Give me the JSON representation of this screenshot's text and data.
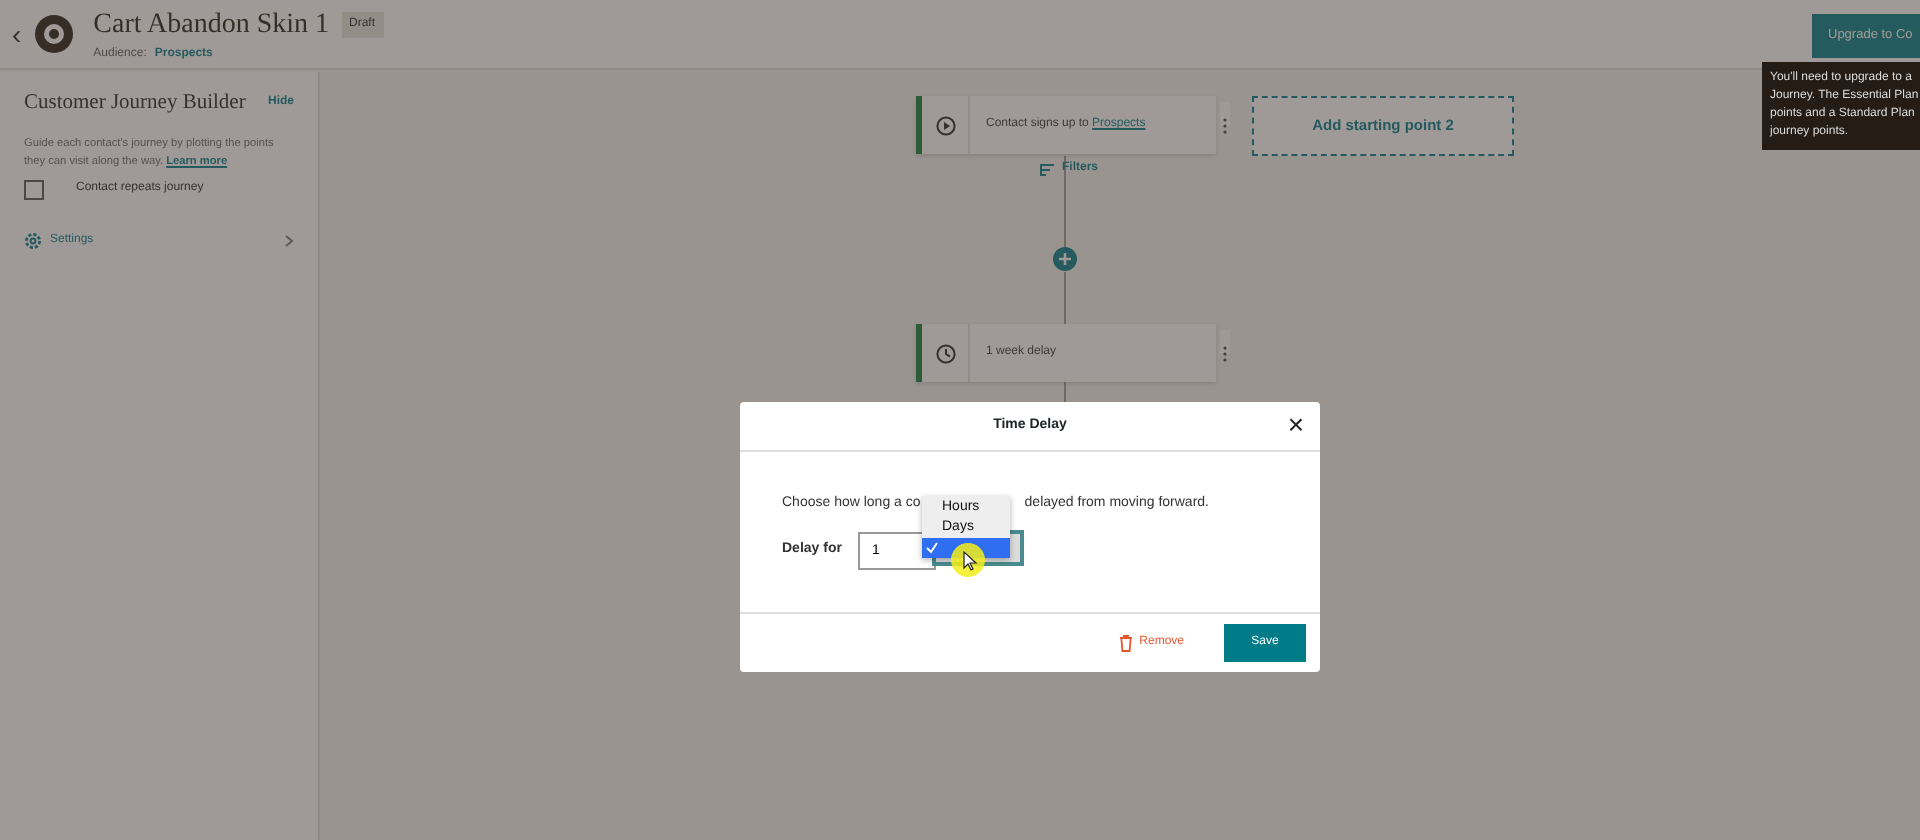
{
  "header": {
    "back": "‹",
    "title": "Cart Abandon Skin 1",
    "status": "Draft",
    "audience_label": "Audience:",
    "audience": "Prospects",
    "upgrade_button": "Upgrade to Co"
  },
  "tooltip": {
    "lines": [
      "You'll need to upgrade to a",
      "Journey. The Essential Plan",
      "points and a Standard Plan",
      "journey points."
    ]
  },
  "sidebar": {
    "title": "Customer Journey Builder",
    "hide": "Hide",
    "description": "Guide each contact's journey by plotting the points they can visit along the way.",
    "learn_more": "Learn more",
    "repeat": {
      "label": "Contact repeats journey",
      "checked": false
    },
    "settings": "Settings"
  },
  "canvas": {
    "nodes": [
      {
        "kind": "trigger",
        "text": "Contact signs up to",
        "link": "Prospects"
      },
      {
        "kind": "delay",
        "text": "1 week delay"
      }
    ],
    "add_start": "Add starting point 2",
    "filters": "Filters"
  },
  "dialog": {
    "title": "Time Delay",
    "close": "×",
    "text_before": "Choose how long a co",
    "text_after": "delayed from moving forward.",
    "delay_label": "Delay for",
    "delay_value": "1",
    "options": [
      {
        "label": "Hours",
        "selected": false
      },
      {
        "label": "Days",
        "selected": false
      },
      {
        "selected": true
      }
    ],
    "remove": "Remove",
    "save": "Save"
  }
}
